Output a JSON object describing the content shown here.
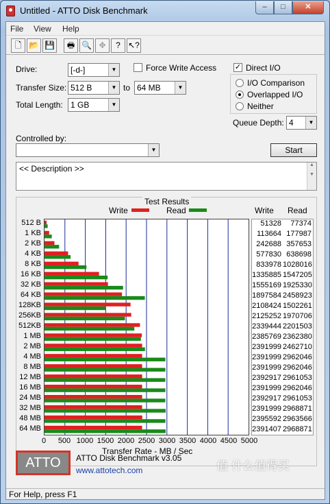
{
  "window": {
    "title": "Untitled - ATTO Disk Benchmark",
    "min_glyph": "–",
    "max_glyph": "□",
    "close_glyph": "✕"
  },
  "menu": [
    {
      "label": "File"
    },
    {
      "label": "View"
    },
    {
      "label": "Help"
    }
  ],
  "toolbar": {
    "icons": [
      "new-file-icon",
      "open-folder-icon",
      "save-icon",
      "print-icon",
      "print-preview-icon",
      "move-icon",
      "help-icon",
      "context-help-icon"
    ]
  },
  "settings": {
    "drive_label": "Drive:",
    "drive_value": "[-d-]",
    "force_write_label": "Force Write Access",
    "force_write_checked": false,
    "transfer_label": "Transfer Size:",
    "transfer_from": "512 B",
    "to_label": "to",
    "transfer_to": "64 MB",
    "total_length_label": "Total Length:",
    "total_length_value": "1 GB",
    "direct_io_label": "Direct I/O",
    "direct_io_checked": true,
    "io_options": [
      {
        "label": "I/O Comparison",
        "selected": false
      },
      {
        "label": "Overlapped I/O",
        "selected": true
      },
      {
        "label": "Neither",
        "selected": false
      }
    ],
    "queue_depth_label": "Queue Depth:",
    "queue_depth_value": "4",
    "controlled_by_label": "Controlled by:",
    "controlled_by_value": "",
    "start_label": "Start",
    "description_text": "<< Description >>"
  },
  "results": {
    "title": "Test Results",
    "legend_write": "Write",
    "legend_read": "Read",
    "col_write": "Write",
    "col_read": "Read",
    "write_color": "#e02020",
    "read_color": "#1a8a1a"
  },
  "chart_data": {
    "type": "bar",
    "orientation": "horizontal",
    "categories": [
      "512 B",
      "1 KB",
      "2 KB",
      "4 KB",
      "8 KB",
      "16 KB",
      "32 KB",
      "64 KB",
      "128KB",
      "256KB",
      "512KB",
      "1 MB",
      "2 MB",
      "4 MB",
      "8 MB",
      "12 MB",
      "16 MB",
      "24 MB",
      "32 MB",
      "48 MB",
      "64 MB"
    ],
    "series": [
      {
        "name": "Write",
        "values": [
          51328,
          113664,
          242688,
          577830,
          833978,
          1335885,
          1555169,
          1897584,
          2108424,
          2125252,
          2339444,
          2385769,
          2391999,
          2391999,
          2391999,
          2392917,
          2391999,
          2392917,
          2391999,
          2395592,
          2391407
        ]
      },
      {
        "name": "Read",
        "values": [
          77374,
          177987,
          357653,
          638698,
          1028016,
          1547205,
          1925330,
          2458923,
          1502261,
          1970706,
          2201503,
          2362380,
          2462710,
          2962046,
          2962046,
          2961053,
          2962046,
          2961053,
          2968871,
          2963566,
          2968871
        ]
      }
    ],
    "xlabel": "Transfer Rate - MB / Sec",
    "xlim": [
      0,
      5000
    ],
    "xticks": [
      "0",
      "500",
      "1000",
      "1500",
      "2000",
      "2500",
      "3000",
      "3500",
      "4000",
      "4500",
      "5000"
    ],
    "grid": true,
    "legend": "top"
  },
  "footer": {
    "logo_text": "ATTO",
    "product": "ATTO Disk Benchmark v3.05",
    "url": "www.attotech.com"
  },
  "status": {
    "text": "For Help, press F1"
  },
  "watermark": {
    "text": "值 什么值得买"
  }
}
